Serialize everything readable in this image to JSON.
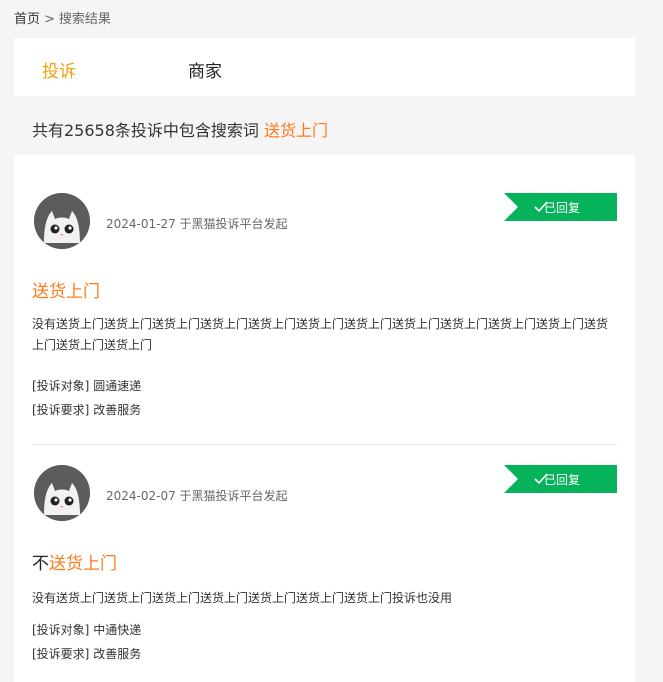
{
  "breadcrumb": {
    "home": "首页",
    "separator": ">",
    "current": "搜索结果"
  },
  "tabs": [
    {
      "label": "投诉",
      "active": true
    },
    {
      "label": "商家",
      "active": false
    }
  ],
  "summary": {
    "prefix": "共有25658条投诉中包含搜索词 ",
    "keyword": "送货上门"
  },
  "colors": {
    "accent": "#f0a10f",
    "keyword": "#ff7a1a",
    "replied_badge": "#07b35a"
  },
  "complaints": [
    {
      "date_text": "2024-01-27 于黑猫投诉平台发起",
      "status": "已回复",
      "title_prefix": "",
      "title_highlight": "送货上门",
      "description": "没有送货上门送货上门送货上门送货上门送货上门送货上门送货上门送货上门送货上门送货上门送货上门送货上门送货上门送货上门",
      "target_label": "[投诉对象]",
      "target": "圆通速递",
      "request_label": "[投诉要求]",
      "request": "改善服务"
    },
    {
      "date_text": "2024-02-07 于黑猫投诉平台发起",
      "status": "已回复",
      "title_prefix": "不",
      "title_highlight": "送货上门",
      "description": "没有送货上门送货上门送货上门送货上门送货上门送货上门送货上门投诉也没用",
      "target_label": "[投诉对象]",
      "target": "中通快递",
      "request_label": "[投诉要求]",
      "request": "改善服务"
    }
  ]
}
